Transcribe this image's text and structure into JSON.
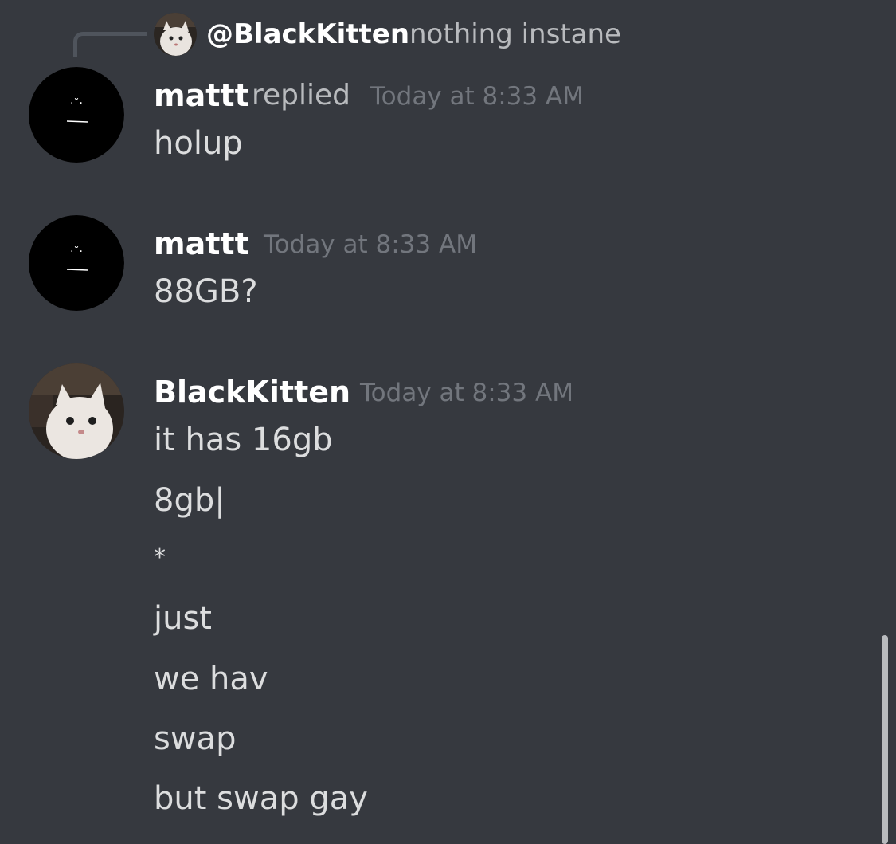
{
  "reply": {
    "mention": "@BlackKitten",
    "text": "nothing instane"
  },
  "messages": [
    {
      "author": "mattt",
      "replied_label": "replied",
      "timestamp": "Today at 8:33 AM",
      "lines": [
        "holup"
      ]
    },
    {
      "author": "mattt",
      "timestamp": "Today at 8:33 AM",
      "lines": [
        "88GB?"
      ]
    },
    {
      "author": "BlackKitten",
      "timestamp": "Today at 8:33 AM",
      "lines": [
        "it has 16gb",
        "8gb|",
        "*",
        "just",
        "we hav",
        "swap",
        "but swap gay"
      ]
    }
  ],
  "colors": {
    "background": "#36393f",
    "username": "#ffffff",
    "timestamp": "#72767d",
    "text": "#dcddde"
  }
}
